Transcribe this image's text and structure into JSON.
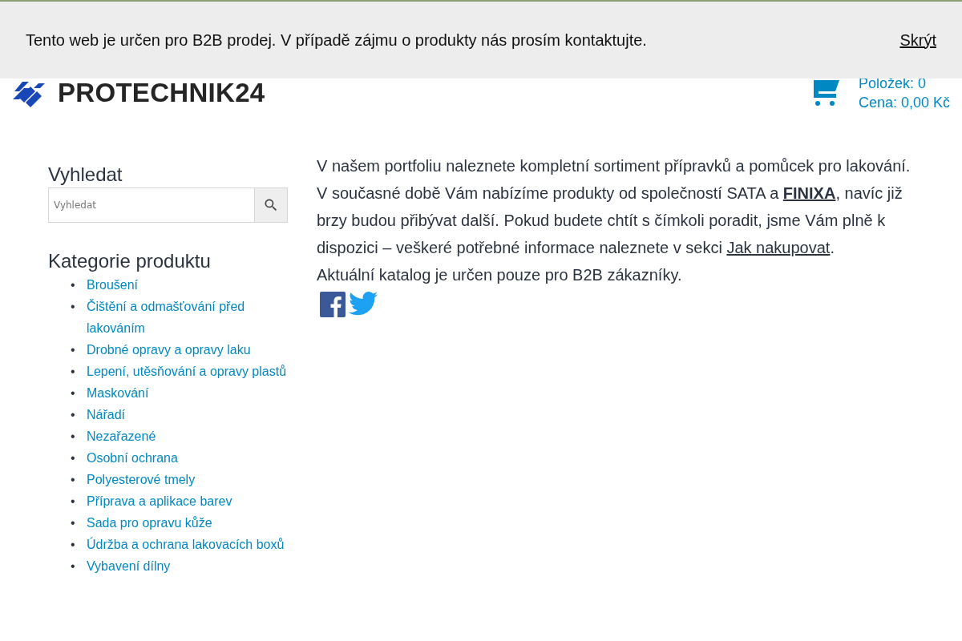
{
  "cookie_banner": {
    "message": "Tento web je určen pro B2B prodej. V případě zájmu o produkty nás prosím kontaktujte.",
    "dismiss": "Skrýt"
  },
  "header": {
    "logo": "PROTECHNIK24",
    "cart": {
      "items": "Položek: 0",
      "price": "Cena: 0,00 Kč"
    }
  },
  "sidebar": {
    "search": {
      "title": "Vyhledat",
      "placeholder": "Vyhledat"
    },
    "categories": {
      "title": "Kategorie produktu",
      "marker": "•",
      "items": [
        "Broušení",
        "Čištění a odmašťování před lakováním",
        "Drobné opravy a opravy laku",
        "Lepení, utěsňování a opravy plastů",
        "Maskování",
        "Nářadí",
        "Nezařazené",
        "Osobní ochrana",
        "Polyesterové tmely",
        "Příprava a aplikace barev",
        "Sada pro opravu kůže",
        "Údržba a ochrana lakovacích boxů",
        "Vybavení dílny"
      ]
    }
  },
  "content": {
    "paragraphs": [
      [
        {
          "kind": "text",
          "text": "V našem portfoliu naleznete kompletní sortiment přípravků a pomůcek pro lakování. V současné době Vám nabízíme produkty od společností SATA a "
        },
        {
          "kind": "link",
          "bold": true,
          "text": "FINIXA"
        },
        {
          "kind": "text",
          "text": ", navíc již brzy budou přibývat další. Pokud budete chtít s čímkoli poradit, jsme Vám plně k dispozici – veškeré potřebné informace naleznete v sekci "
        },
        {
          "kind": "link",
          "bold": false,
          "text": "Jak nakupovat"
        },
        {
          "kind": "text",
          "text": "."
        }
      ],
      [
        {
          "kind": "text",
          "text": "Aktuální katalog je určen pouze pro B2B zákazníky."
        }
      ]
    ],
    "share": [
      {
        "kind": "facebook"
      },
      {
        "kind": "twitter"
      }
    ]
  }
}
